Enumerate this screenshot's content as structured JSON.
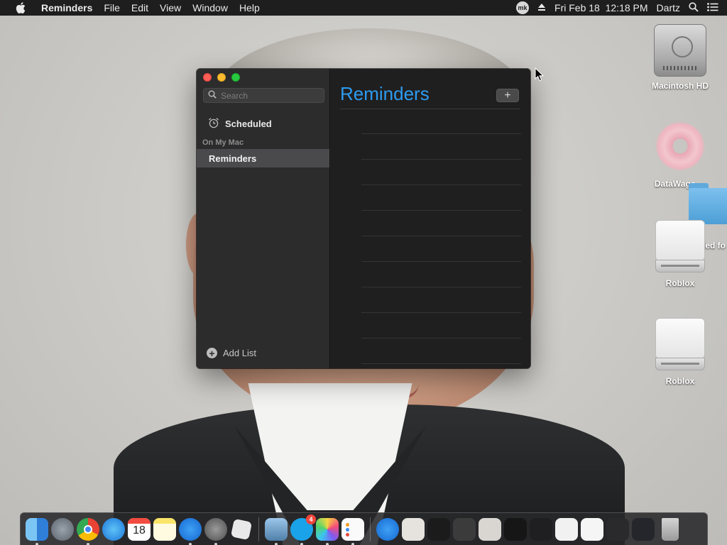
{
  "menubar": {
    "app_name": "Reminders",
    "items": [
      "File",
      "Edit",
      "View",
      "Window",
      "Help"
    ],
    "status_app_label": "mk",
    "datetime": "Fri Feb 18  12:18 PM",
    "user": "Dartz"
  },
  "desktop": {
    "icons": [
      {
        "label": "Macintosh HD"
      },
      {
        "label": "DataWago"
      },
      {
        "label": "led fo"
      },
      {
        "label": "Roblox"
      },
      {
        "label": "Roblox"
      }
    ]
  },
  "window": {
    "search_placeholder": "Search",
    "scheduled_label": "Scheduled",
    "section_label": "On My Mac",
    "lists": [
      {
        "label": "Reminders",
        "selected": true
      }
    ],
    "add_list_label": "Add List",
    "main_title": "Reminders",
    "add_button_label": "+",
    "accent_color": "#2d9bf0"
  },
  "dock": {
    "calendar_day": "18",
    "mk_badge": "4",
    "apps": [
      "finder-icon",
      "launchpad-icon",
      "chrome-icon",
      "safari-icon",
      "calendar-icon",
      "notes-icon",
      "app-store-icon",
      "system-preferences-icon",
      "roblox-icon",
      "preview-icon",
      "mk-app-icon",
      "color-icon",
      "reminders-icon",
      "app-store-download-icon",
      "trash-icon"
    ]
  }
}
